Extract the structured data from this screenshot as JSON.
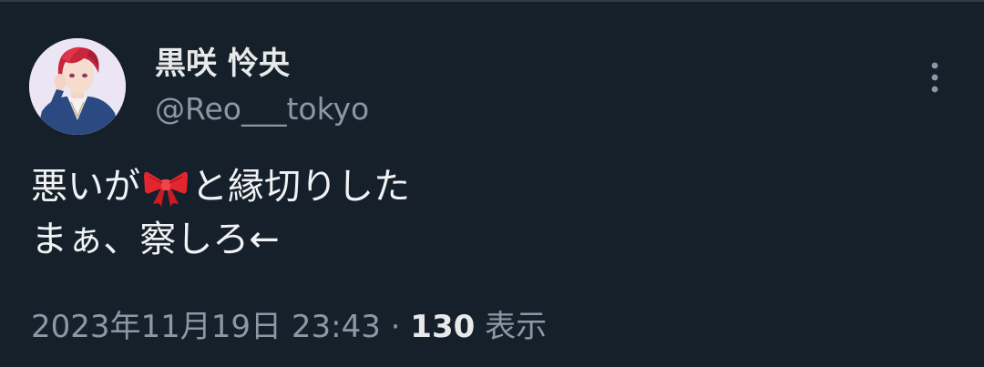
{
  "user": {
    "display_name": "黒咲 怜央",
    "handle": "@Reo___tokyo"
  },
  "tweet": {
    "line1_before": "悪いが",
    "emoji": "ribbon-emoji",
    "line1_after": "と縁切りした",
    "line2": "まぁ、察しろ←"
  },
  "meta": {
    "timestamp": "2023年11月19日 23:43",
    "separator": " · ",
    "views_count": "130",
    "views_label": " 表示"
  },
  "icons": {
    "more": "more-vertical-icon",
    "ribbon": "ribbon-emoji"
  },
  "colors": {
    "background": "#15202b",
    "primary_text": "#e7e9ea",
    "secondary_text": "#8b98a5",
    "ribbon": "#e3262e"
  }
}
